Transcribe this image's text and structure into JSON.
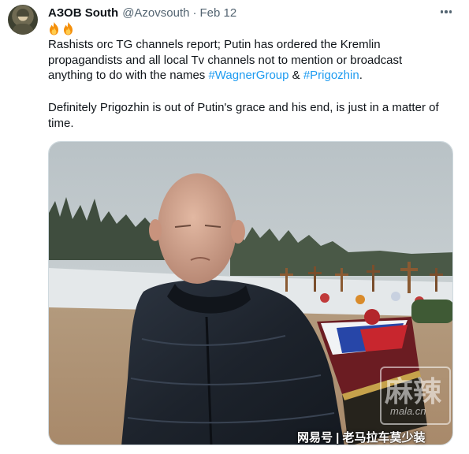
{
  "tweet": {
    "display_name": "АЗОВ South",
    "handle": "@Azovsouth",
    "separator": "·",
    "date": "Feb 12",
    "emojis": [
      "fire-icon",
      "fire-icon"
    ],
    "paragraph1": {
      "line1": "Rashists orc TG channels report; Putin has ordered the Kremlin",
      "line2": "propagandists and all local Tv channels not to mention or broadcast",
      "line3_prefix": "anything to do with the names ",
      "hashtag1": "#WagnerGroup",
      "line3_mid": " & ",
      "hashtag2": "#Prigozhin",
      "line3_suffix": "."
    },
    "paragraph2": {
      "line1": "Definitely Prigozhin is out of Putin's grace and his end, is just in a matter of",
      "line2": "time."
    },
    "more_icon": "more-horizontal-icon"
  },
  "media": {
    "description_icon": "photo",
    "watermark_glyph": "麻辣",
    "watermark_domain": "mala.cn",
    "credit": "网易号 | 老马拉车莫少装"
  },
  "colors": {
    "text": "#0f1419",
    "secondary": "#536471",
    "link": "#1d9bf0",
    "border": "#cfd9de"
  }
}
